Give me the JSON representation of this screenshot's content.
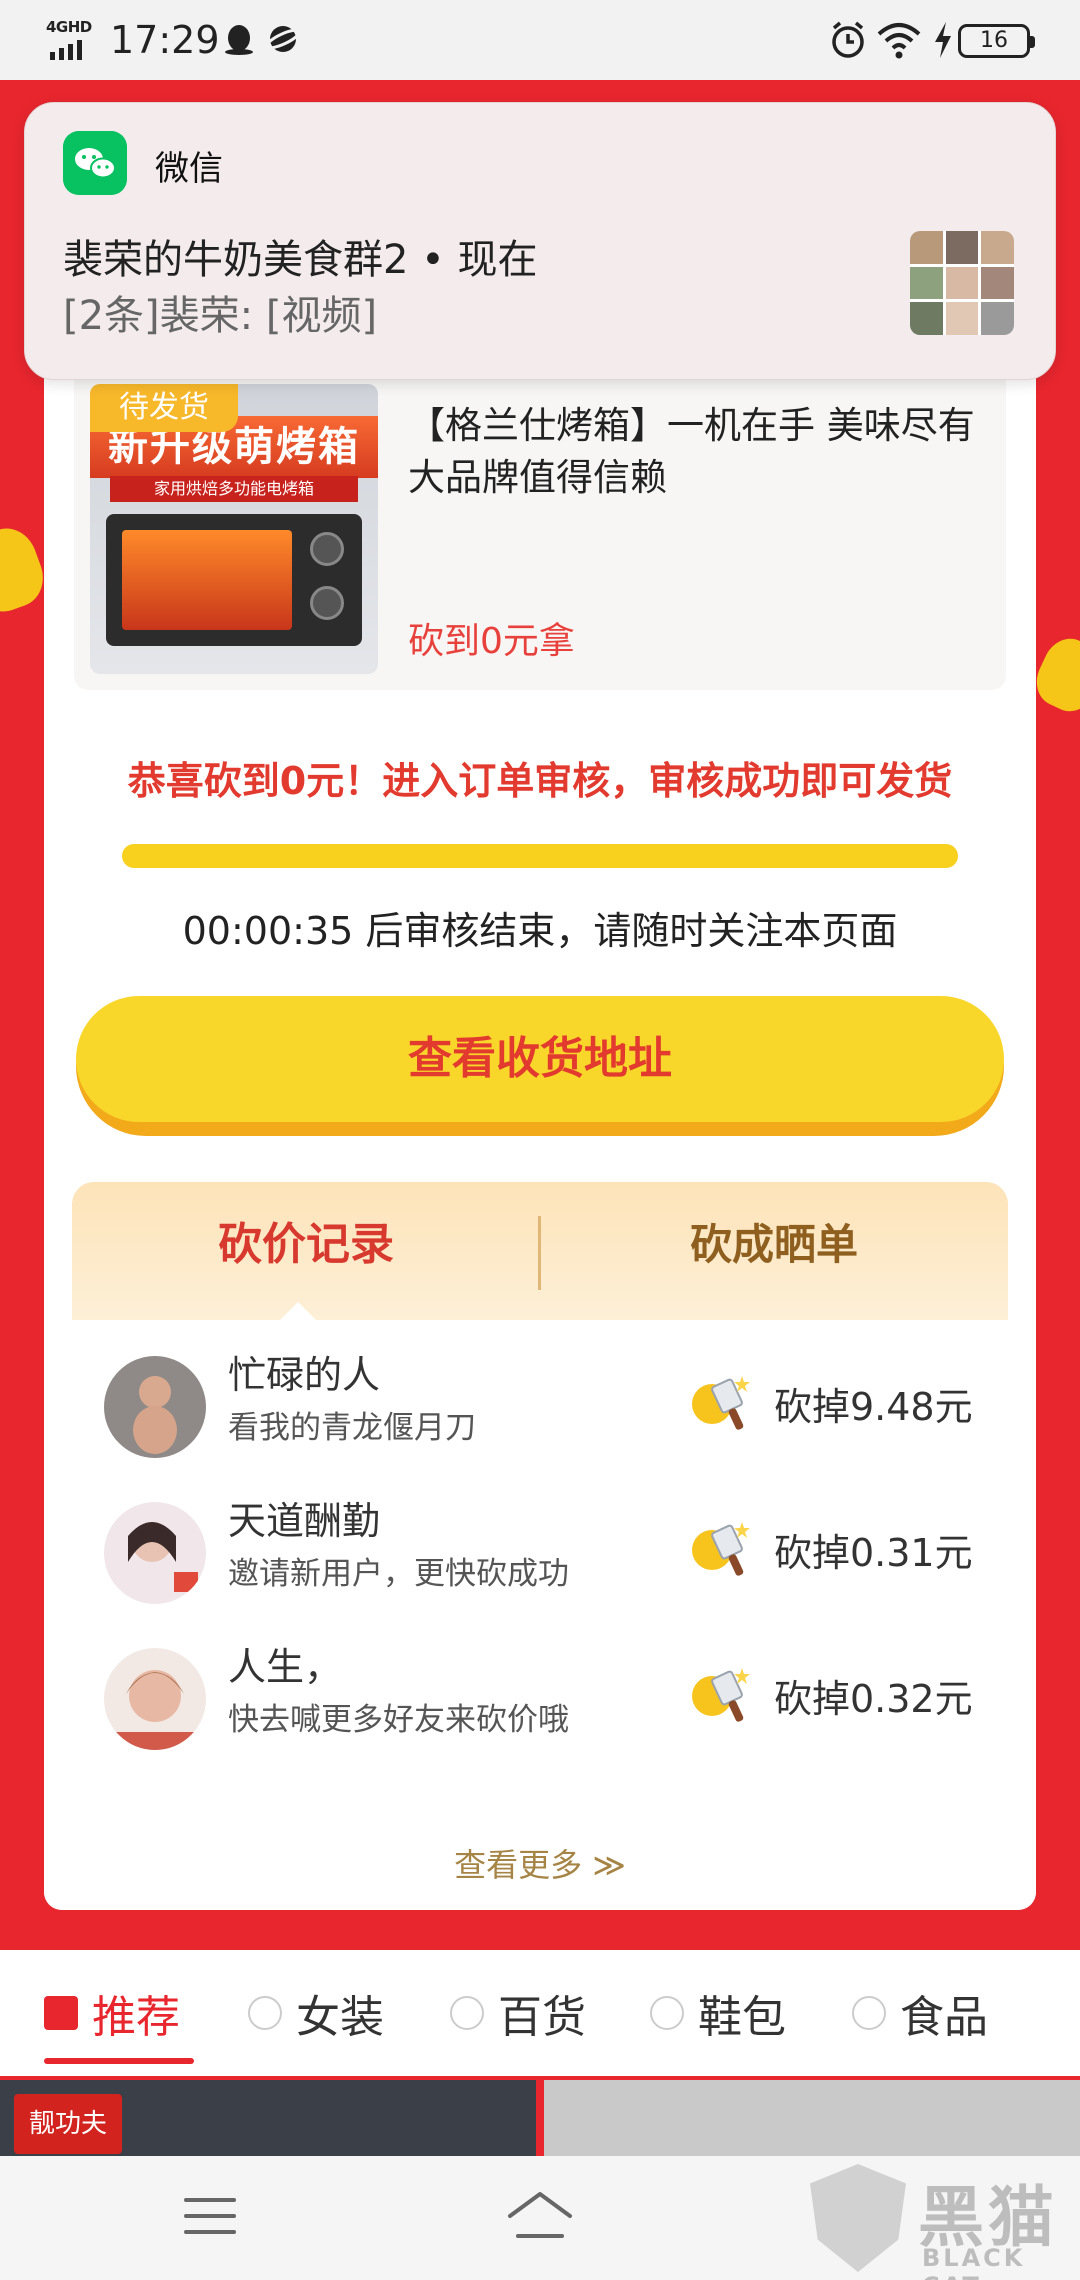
{
  "status_bar": {
    "network": "4GHD",
    "time": "17:29",
    "battery": "16",
    "icons": [
      "qq-icon",
      "planet-icon",
      "alarm-icon",
      "wifi-icon",
      "charging-icon"
    ]
  },
  "notification": {
    "app_name": "微信",
    "title": "裴荣的牛奶美食群2 • 现在",
    "body": "[2条]裴荣: [视频]",
    "icon": "wechat-icon"
  },
  "product": {
    "badge": "待发货",
    "image_banner": "新升级萌烤箱",
    "image_sub": "家用烘焙多功能电烤箱",
    "title": "【格兰仕烤箱】一机在手 美味尽有 大品牌值得信赖",
    "price_text": "砍到0元拿"
  },
  "congrats": "恭喜砍到0元！进入订单审核，审核成功即可发货",
  "progress": {
    "percent": 100
  },
  "countdown": "00:00:35 后审核结束，请随时关注本页面",
  "cta_label": "查看收货地址",
  "tabs": [
    {
      "label": "砍价记录",
      "active": true
    },
    {
      "label": "砍成晒单",
      "active": false
    }
  ],
  "records": [
    {
      "name": "忙碌的人",
      "message": "看我的青龙偃月刀",
      "amount": "砍掉9.48元"
    },
    {
      "name": "天道酬勤",
      "message": "邀请新用户，更快砍成功",
      "amount": "砍掉0.31元"
    },
    {
      "name": "人生，",
      "message": "快去喊更多好友来砍价哦",
      "amount": "砍掉0.32元"
    }
  ],
  "more_label": "查看更多 ≫",
  "categories": [
    {
      "label": "推荐",
      "active": true
    },
    {
      "label": "女装",
      "active": false
    },
    {
      "label": "百货",
      "active": false
    },
    {
      "label": "鞋包",
      "active": false
    },
    {
      "label": "食品",
      "active": false
    }
  ],
  "feed": {
    "left_logo": "靓功夫"
  },
  "watermark": {
    "title": "黑猫",
    "subtitle": "BLACK CAT"
  },
  "colors": {
    "brand_red": "#e8262e",
    "cta_yellow": "#f9d72a",
    "wechat_green": "#08c160"
  }
}
